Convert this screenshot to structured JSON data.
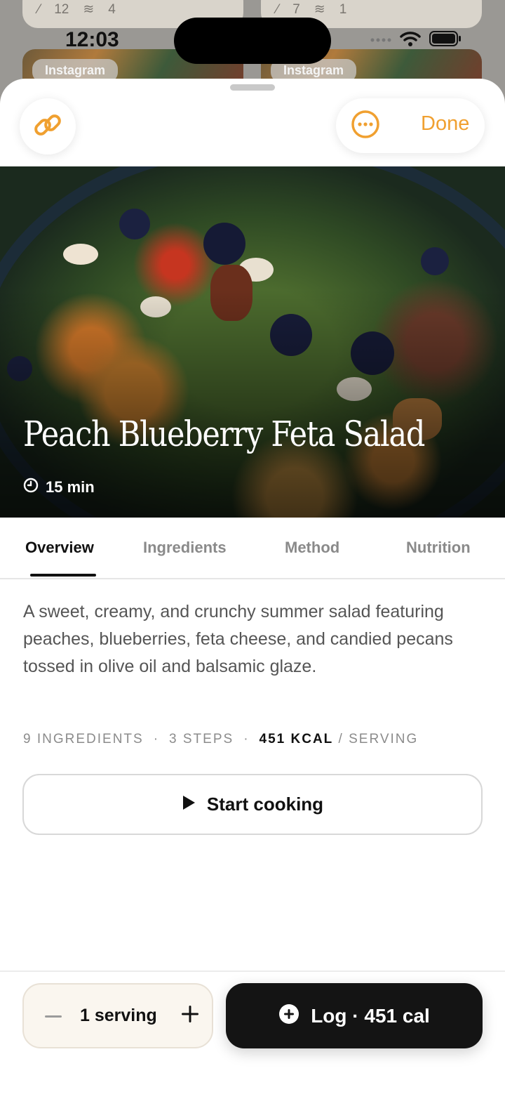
{
  "status_bar": {
    "time": "12:03"
  },
  "background_cards": [
    {
      "stat_a": "12",
      "stat_b": "4",
      "badge": "Instagram"
    },
    {
      "stat_a": "7",
      "stat_b": "1",
      "badge": "Instagram"
    }
  ],
  "header": {
    "done_label": "Done"
  },
  "recipe": {
    "title": "Peach Blueberry Feta Salad",
    "time": "15 min",
    "description": "A sweet, creamy, and crunchy summer salad featuring peaches, blueberries, feta cheese, and candied pecans tossed in olive oil and balsamic glaze.",
    "ingredients_count": "9 INGREDIENTS",
    "steps_count": "3 STEPS",
    "kcal": "451 KCAL",
    "per_serving": "/ SERVING"
  },
  "tabs": [
    {
      "label": "Overview",
      "active": true
    },
    {
      "label": "Ingredients",
      "active": false
    },
    {
      "label": "Method",
      "active": false
    },
    {
      "label": "Nutrition",
      "active": false
    }
  ],
  "actions": {
    "start_cooking": "Start cooking",
    "serving_label": "1 serving",
    "log_label": "Log · 451 cal"
  },
  "colors": {
    "accent": "#f0a030",
    "primary_dark": "#141414"
  },
  "icons": {
    "link": "link-icon",
    "more": "more-icon",
    "clock": "clock-icon",
    "play": "play-icon",
    "minus": "minus-icon",
    "plus": "plus-icon",
    "add_circle": "plus-circle-icon"
  }
}
